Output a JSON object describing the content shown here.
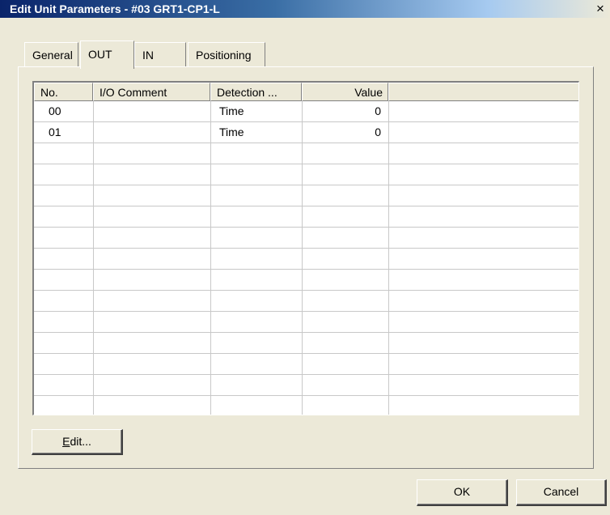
{
  "window": {
    "title": "Edit Unit Parameters - #03 GRT1-CP1-L",
    "close_glyph": "×"
  },
  "tabs": [
    {
      "label": "General",
      "active": false
    },
    {
      "label": "OUT",
      "active": true
    },
    {
      "label": "IN",
      "active": false
    },
    {
      "label": "Positioning",
      "active": false
    }
  ],
  "table": {
    "columns": [
      "No.",
      "I/O Comment",
      "Detection ...",
      "Value"
    ],
    "rows": [
      {
        "no": "00",
        "comment": "",
        "detection": "Time",
        "value": "0"
      },
      {
        "no": "01",
        "comment": "",
        "detection": "Time",
        "value": "0"
      }
    ]
  },
  "buttons": {
    "edit_mnemonic": "E",
    "edit_rest": "dit...",
    "ok": "OK",
    "cancel": "Cancel"
  }
}
